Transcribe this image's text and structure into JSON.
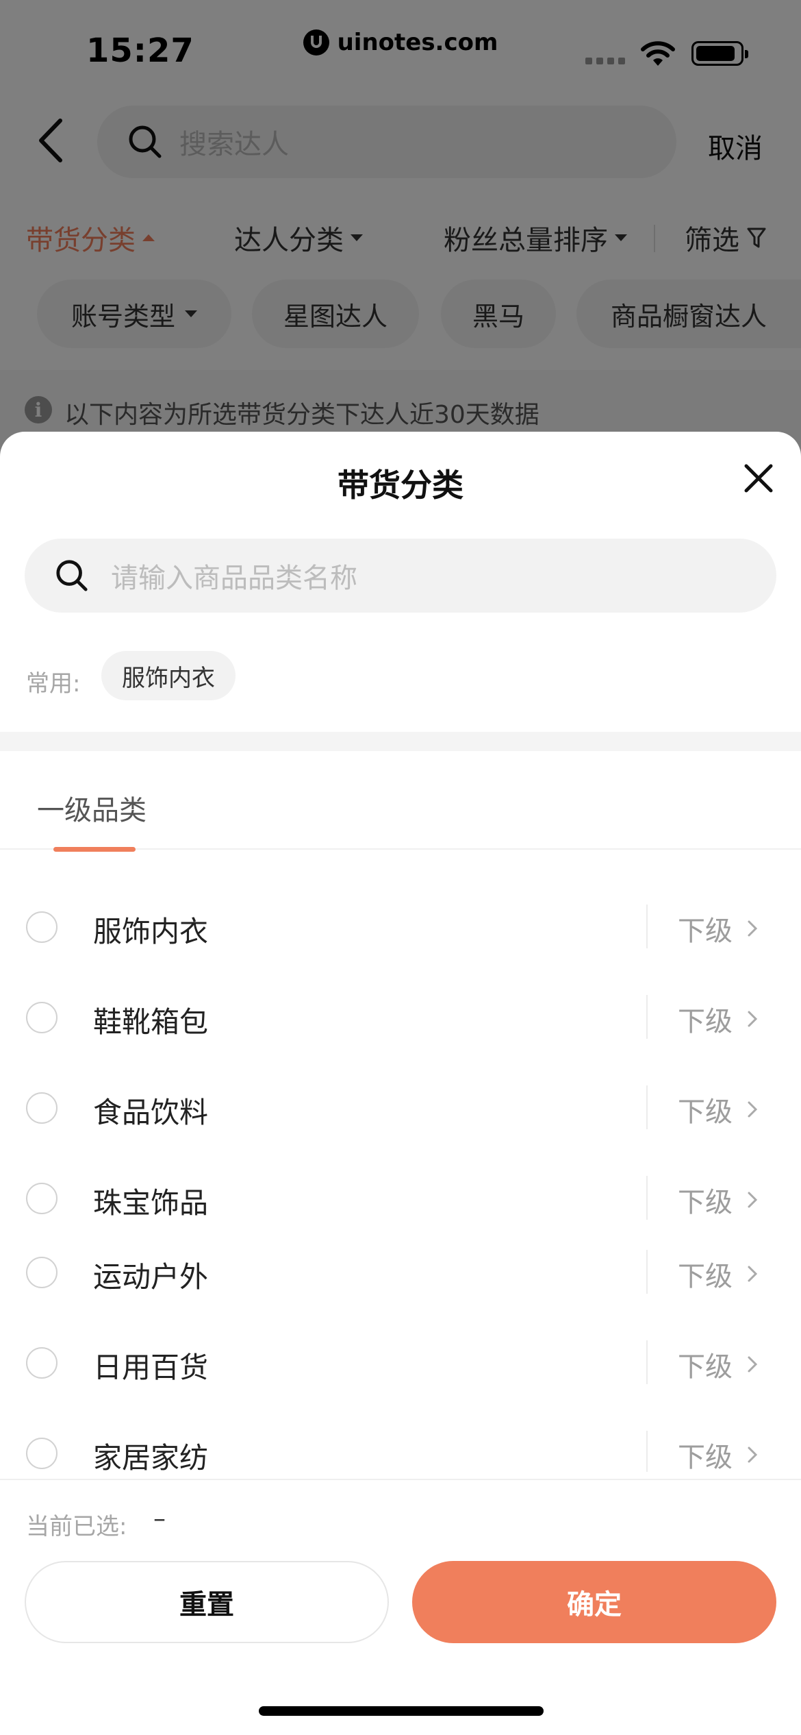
{
  "status_bar": {
    "time": "15:27",
    "url": "uinotes.com",
    "icons": [
      "signal-icon",
      "wifi-icon",
      "battery-icon"
    ]
  },
  "search": {
    "placeholder": "搜索达人",
    "cancel_label": "取消",
    "icon": "search-icon"
  },
  "filters": {
    "items": [
      {
        "label": "带货分类",
        "active": true
      },
      {
        "label": "达人分类",
        "active": false
      },
      {
        "label": "粉丝总量排序",
        "active": false
      },
      {
        "label": "筛选",
        "active": false
      }
    ],
    "tags": [
      "账号类型",
      "星图达人",
      "黑马",
      "商品橱窗达人"
    ]
  },
  "notice": {
    "text": "以下内容为所选带货分类下达人近30天数据",
    "icon": "info-icon"
  },
  "sheet": {
    "title": "带货分类",
    "search_placeholder": "请输入商品品类名称",
    "common_label": "常用:",
    "common_chips": [
      "服饰内衣"
    ],
    "level_tab": "一级品类",
    "sub_label": "下级",
    "categories": [
      "服饰内衣",
      "鞋靴箱包",
      "食品饮料",
      "珠宝饰品",
      "运动户外",
      "日用百货",
      "家居家纺"
    ],
    "selected_label": "当前已选:",
    "selected_value": "–",
    "reset_label": "重置",
    "confirm_label": "确定"
  },
  "colors": {
    "accent": "#f07f5c",
    "overlay": "rgba(0,0,0,0.5)"
  }
}
